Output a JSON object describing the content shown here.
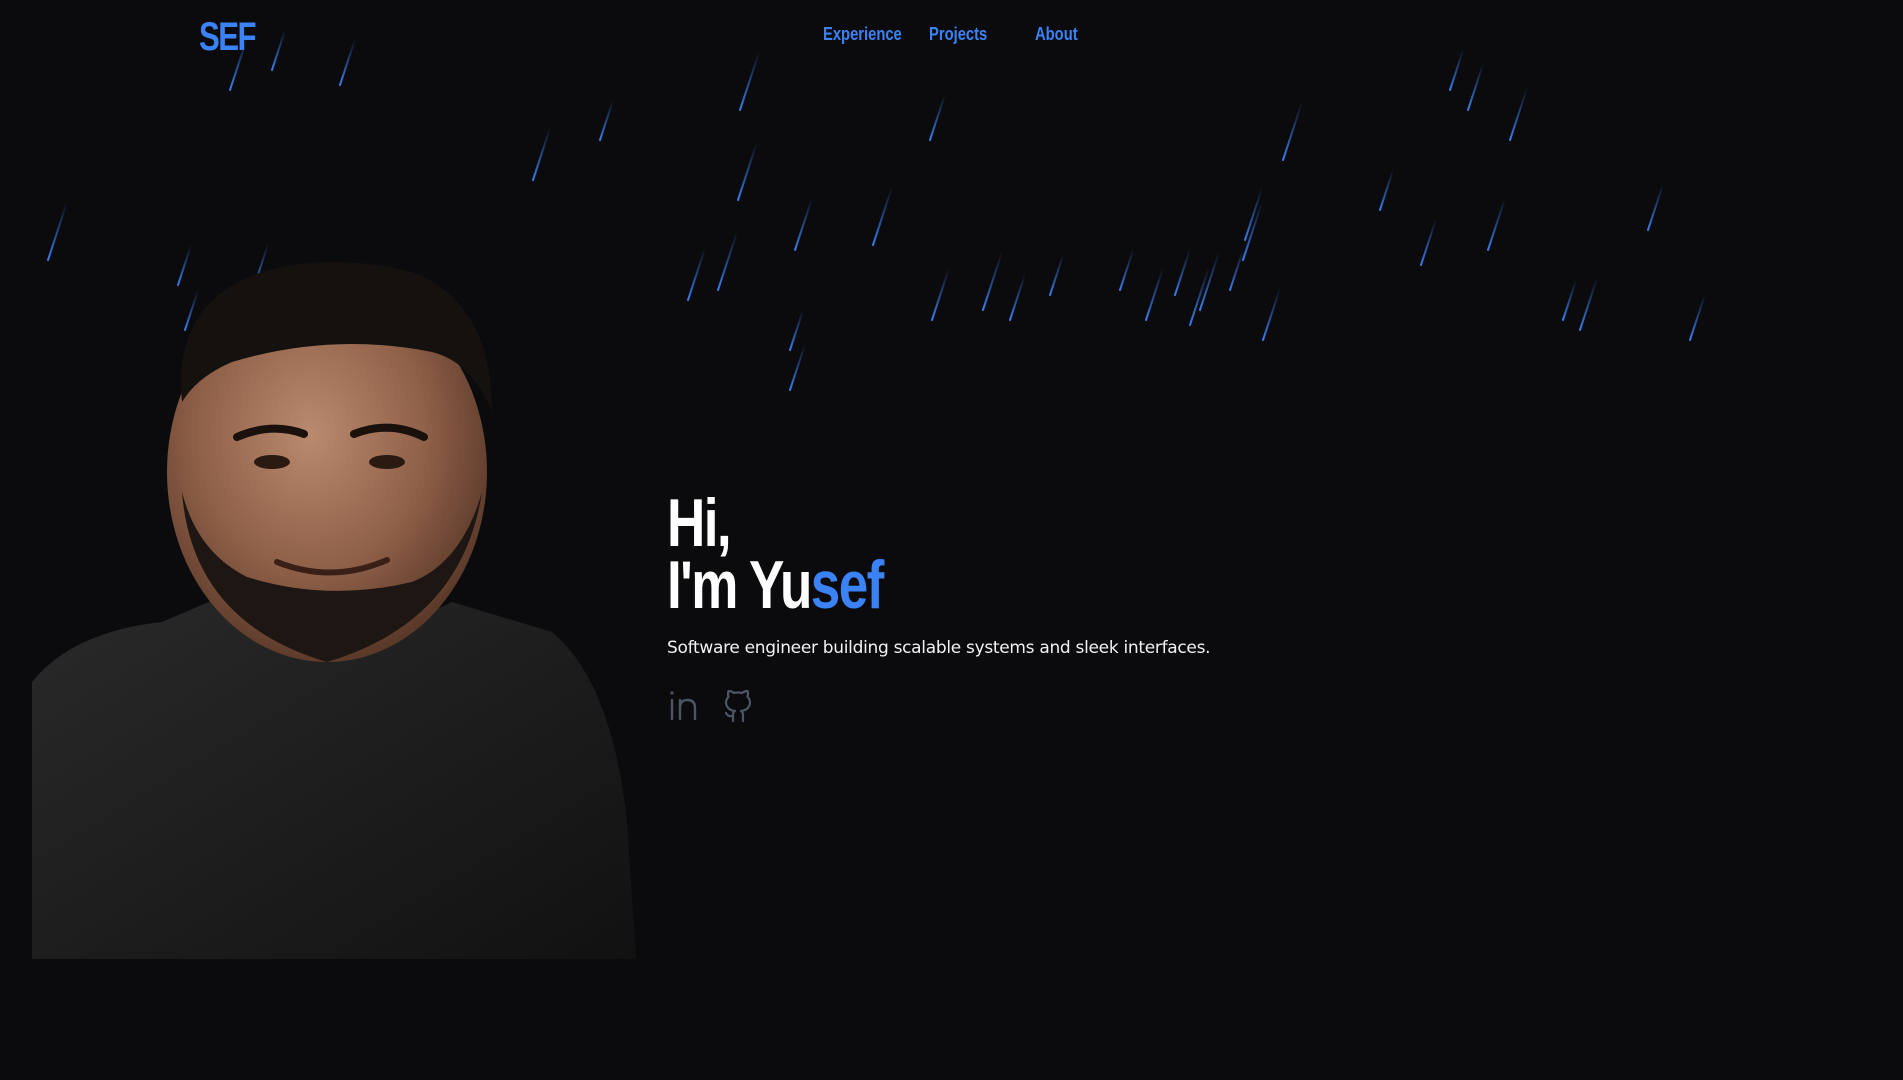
{
  "nav": {
    "logo": "SEF",
    "links": [
      "Experience",
      "Projects",
      "About"
    ]
  },
  "hero": {
    "greeting": "Hi,",
    "name_prefix": "I'm Yu",
    "name_accent": "sef",
    "tagline": "Software engineer building scalable systems and sleek interfaces."
  },
  "socials": [
    {
      "icon": "linkedin-icon"
    },
    {
      "icon": "github-icon"
    }
  ],
  "colors": {
    "background": "#0b0b0e",
    "accent": "#3b82f6",
    "text": "#ffffff",
    "muted_icon": "#4b5563"
  }
}
